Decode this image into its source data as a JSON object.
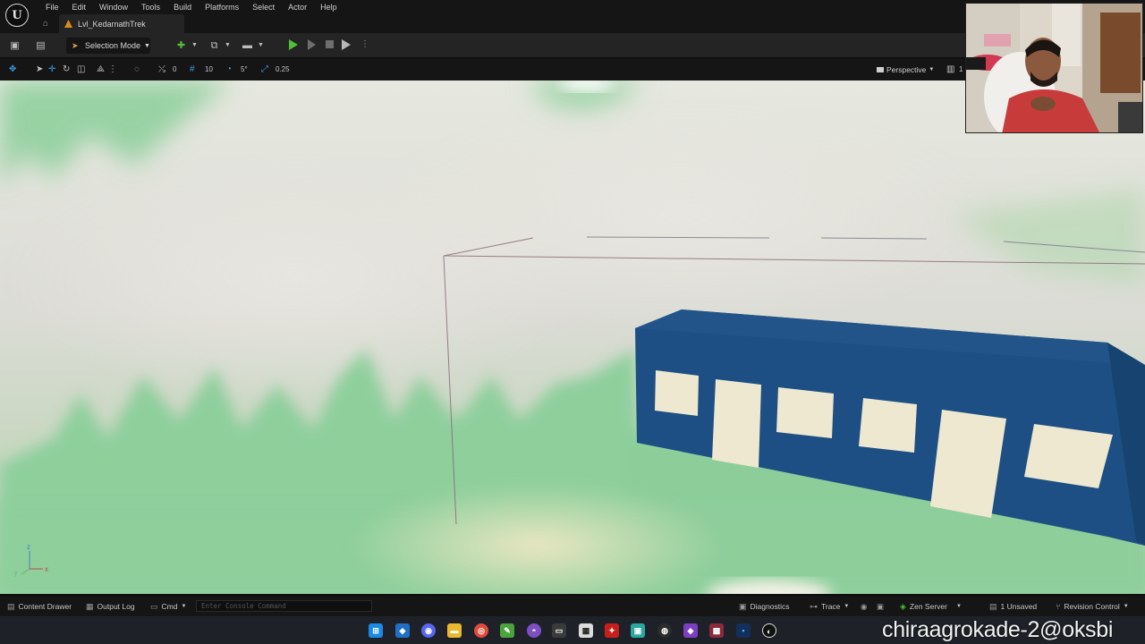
{
  "menu": [
    "File",
    "Edit",
    "Window",
    "Tools",
    "Build",
    "Platforms",
    "Select",
    "Actor",
    "Help"
  ],
  "tab": {
    "level_name": "Lvl_KedarnathTrek"
  },
  "toolbar": {
    "mode_label": "Selection Mode"
  },
  "viewport_toolbar": {
    "rotation_snap_value": "0",
    "grid_snap_value": "10",
    "angle_snap_value": "5°",
    "scale_snap_value": "0.25",
    "view_mode": "Perspective",
    "extra": "1"
  },
  "status": {
    "content_drawer": "Content Drawer",
    "output_log": "Output Log",
    "cmd": "Cmd",
    "console_placeholder": "Enter Console Command",
    "diagnostics": "Diagnostics",
    "trace": "Trace",
    "zen_server": "Zen Server",
    "unsaved": "1 Unsaved",
    "revision_control": "Revision Control"
  },
  "overlay": {
    "username": "chiraagrokade-2@oksbi"
  },
  "colors": {
    "building": "#1d4f84",
    "building_roof": "#22548a",
    "window": "#ede8cf",
    "ground": "#8fcf9c",
    "play": "#4fbf3a"
  }
}
